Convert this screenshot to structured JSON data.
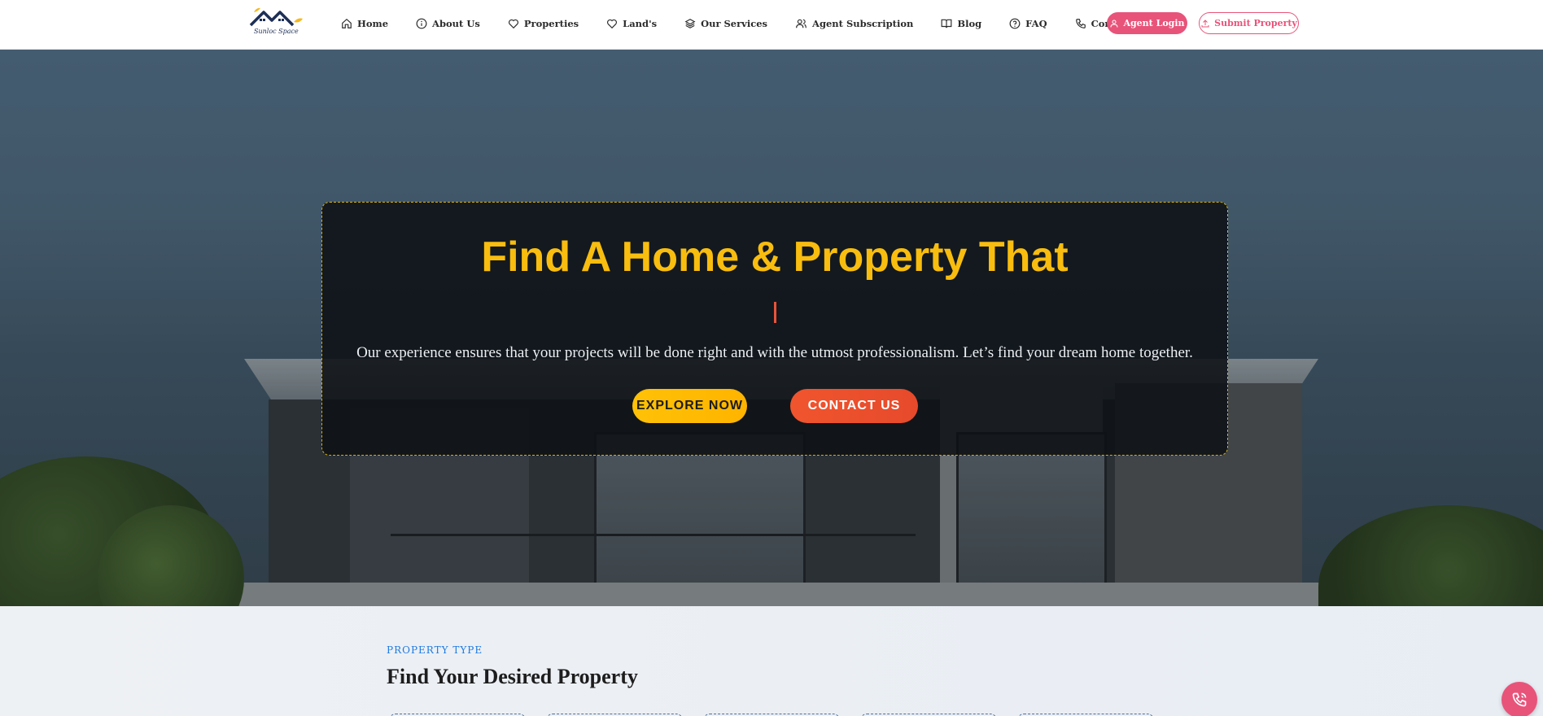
{
  "brand": {
    "name": "Sunloc Space"
  },
  "nav": {
    "items": [
      {
        "label": "Home",
        "icon": "home-icon"
      },
      {
        "label": "About Us",
        "icon": "info-icon"
      },
      {
        "label": "Properties",
        "icon": "heart-icon"
      },
      {
        "label": "Land's",
        "icon": "heart-icon"
      },
      {
        "label": "Our Services",
        "icon": "layers-icon"
      },
      {
        "label": "Agent Subscription",
        "icon": "users-icon"
      },
      {
        "label": "Blog",
        "icon": "book-icon"
      },
      {
        "label": "FAQ",
        "icon": "help-circle-icon"
      },
      {
        "label": "Contact Us",
        "icon": "phone-icon"
      }
    ],
    "login_label": "Agent Login",
    "submit_label": "Submit Property"
  },
  "hero": {
    "title": "Find A Home & Property That",
    "subtitle": "Our experience ensures that your projects will be done right and with the utmost professionalism. Let’s find your dream home together.",
    "explore_label": "EXPLORE NOW",
    "contact_label": "CONTACT US"
  },
  "property_section": {
    "eyebrow": "PROPERTY TYPE",
    "title": "Find Your Desired Property"
  },
  "colors": {
    "accent_pink": "#e8537a",
    "hero_yellow": "#f8bd0e",
    "cta_orange": "#f0552e",
    "eyebrow_blue": "#1f7ae0"
  }
}
